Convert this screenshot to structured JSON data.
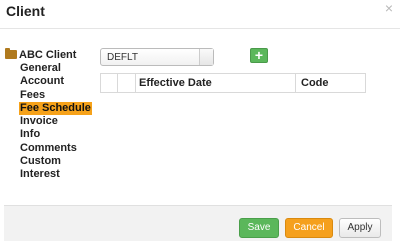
{
  "window": {
    "title": "Client",
    "close_glyph": "×"
  },
  "tree": {
    "root": "ABC Client",
    "items": [
      "General",
      "Account",
      "Fees",
      "Fee Schedule",
      "Invoice",
      "Info",
      "Comments",
      "Custom",
      "Interest"
    ],
    "selected": "Fee Schedule"
  },
  "schedule_select": {
    "value": "DEFLT"
  },
  "add_button": {
    "label": "+"
  },
  "grid": {
    "columns": [
      "",
      "",
      "Effective Date",
      "Code"
    ],
    "rows": []
  },
  "footer": {
    "save": "Save",
    "cancel": "Cancel",
    "apply": "Apply"
  },
  "colors": {
    "save": "#5bb75b",
    "cancel": "#f5a01d",
    "selected": "#f6a21a",
    "folder": "#b07a1e"
  }
}
